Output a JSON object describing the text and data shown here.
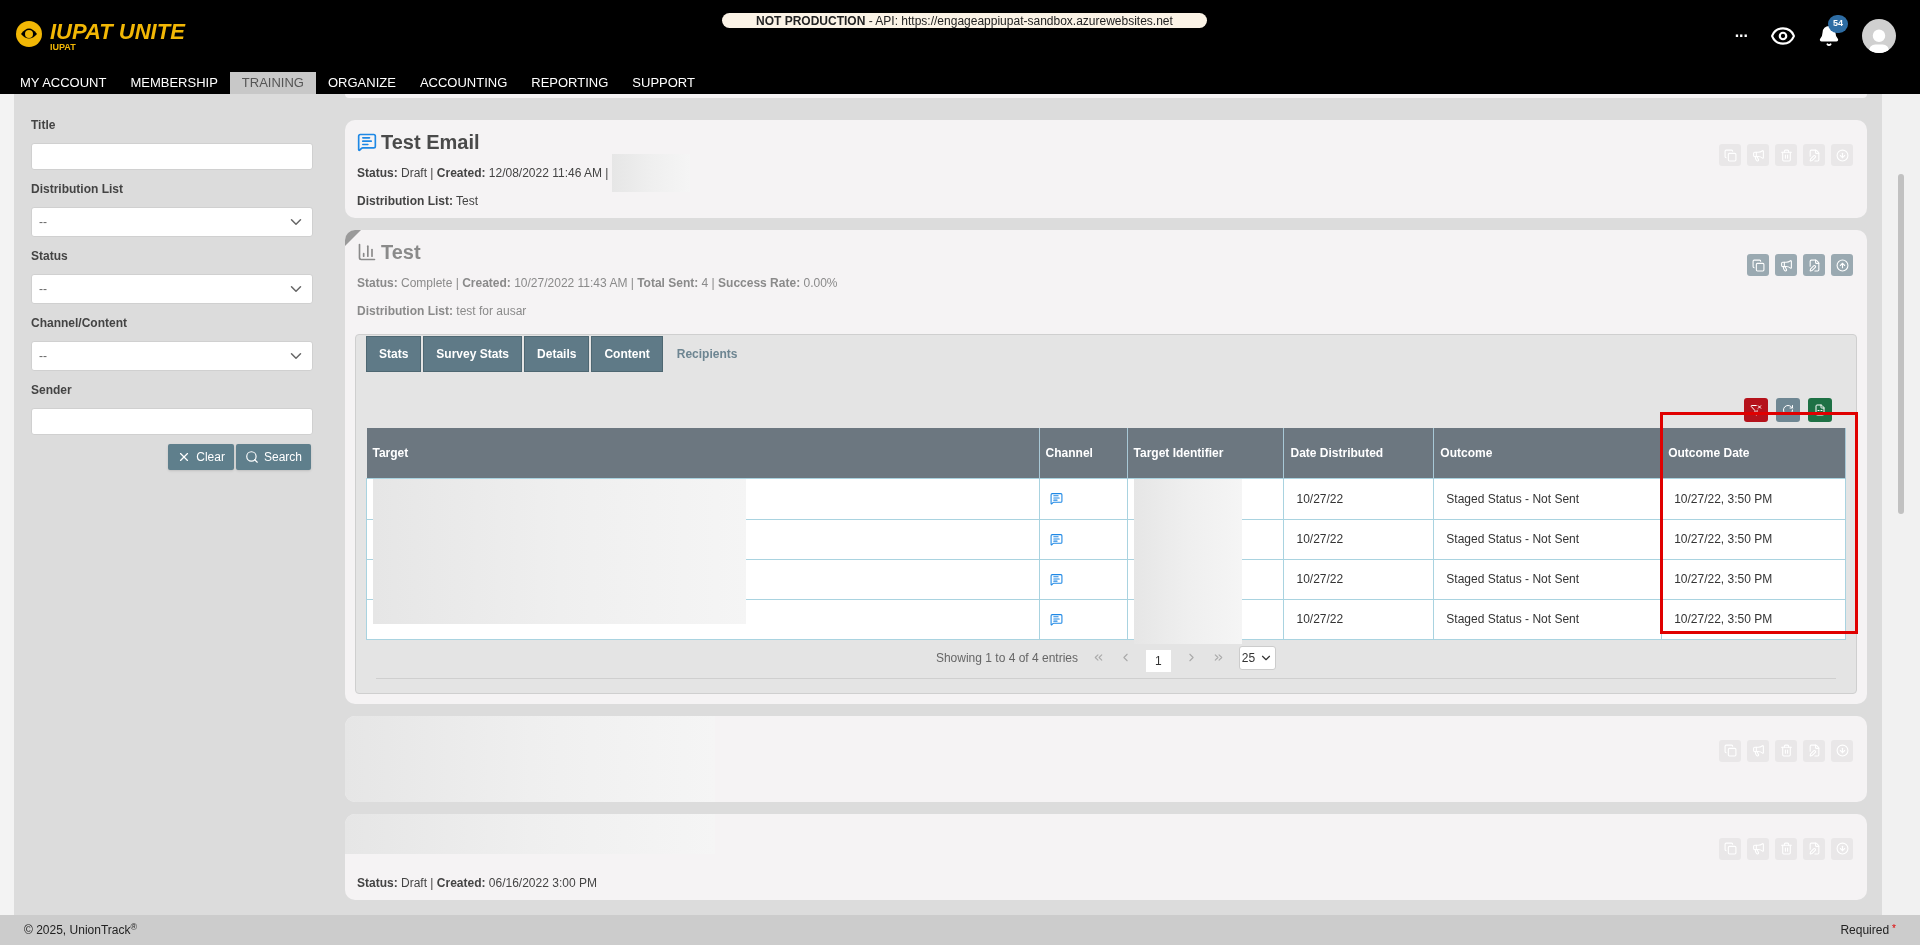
{
  "header": {
    "logo_text": "IUPAT UNITE",
    "logo_sub": "IUPAT",
    "env_label": "NOT PRODUCTION",
    "env_text": " - API: https://engageappiupat-sandbox.azurewebsites.net",
    "more": "...",
    "notification_count": "54"
  },
  "nav": [
    {
      "label": "MY ACCOUNT",
      "selected": false
    },
    {
      "label": "MEMBERSHIP",
      "selected": false
    },
    {
      "label": "TRAINING",
      "selected": true
    },
    {
      "label": "ORGANIZE",
      "selected": false
    },
    {
      "label": "ACCOUNTING",
      "selected": false
    },
    {
      "label": "REPORTING",
      "selected": false
    },
    {
      "label": "SUPPORT",
      "selected": false
    }
  ],
  "filter": {
    "fields": [
      {
        "label": "Title",
        "kind": "text"
      },
      {
        "label": "Distribution List",
        "kind": "select",
        "value": "--"
      },
      {
        "label": "Status",
        "kind": "select",
        "value": "--"
      },
      {
        "label": "Channel/Content",
        "kind": "select",
        "value": "--"
      },
      {
        "label": "Sender",
        "kind": "text"
      }
    ],
    "buttons": [
      {
        "label": "Clear",
        "kind": "clear"
      },
      {
        "label": "Search",
        "kind": "search"
      }
    ]
  },
  "cards": [
    {
      "kind": "email",
      "title": "Test Email",
      "meta": "**Status:** Draft | **Created:** 12/08/2022 11:46 AM |",
      "meta_redacted": true,
      "distribution": "**Distribution List:** Test",
      "faded": true,
      "actions": [
        {
          "kind": "copy"
        },
        {
          "kind": "announce"
        },
        {
          "kind": "delete"
        },
        {
          "kind": "edit"
        },
        {
          "kind": "download"
        }
      ]
    },
    {
      "kind": "survey",
      "title": "Test",
      "meta": "**Status:** Complete | **Created:** 10/27/2022 11:43 AM | **Total Sent:** 4 | **Success Rate:** 0.00%",
      "distribution": "**Distribution List:** test for ausar",
      "faded": false,
      "actions": [
        {
          "kind": "copy"
        },
        {
          "kind": "announce"
        },
        {
          "kind": "edit"
        },
        {
          "kind": "upload"
        }
      ],
      "details": {
        "tabs": [
          {
            "label": "Stats",
            "selected": false
          },
          {
            "label": "Survey Stats",
            "selected": false
          },
          {
            "label": "Details",
            "selected": false
          },
          {
            "label": "Content",
            "selected": false
          },
          {
            "label": "Recipients",
            "selected": true
          }
        ],
        "toolbar": [
          {
            "kind": "clear-filter"
          },
          {
            "kind": "refresh"
          },
          {
            "kind": "export"
          }
        ],
        "columns": [
          {
            "label": "Target",
            "highlighted": false
          },
          {
            "label": "Channel",
            "highlighted": false
          },
          {
            "label": "Target Identifier",
            "highlighted": false
          },
          {
            "label": "Date Distributed",
            "highlighted": false
          },
          {
            "label": "Outcome",
            "highlighted": false
          },
          {
            "label": "Outcome Date",
            "highlighted": true
          }
        ],
        "rows": [
          {
            "date": "10/27/22",
            "outcome": "Staged Status - Not Sent",
            "outcome_date": "10/27/22, 3:50 PM"
          },
          {
            "date": "10/27/22",
            "outcome": "Staged Status - Not Sent",
            "outcome_date": "10/27/22, 3:50 PM"
          },
          {
            "date": "10/27/22",
            "outcome": "Staged Status - Not Sent",
            "outcome_date": "10/27/22, 3:50 PM"
          },
          {
            "date": "10/27/22",
            "outcome": "Staged Status - Not Sent",
            "outcome_date": "10/27/22, 3:50 PM"
          }
        ],
        "pagination": {
          "summary": "Showing 1 to 4 of 4 entries",
          "page": "1",
          "page_size": "25"
        }
      }
    },
    {
      "kind": "hidden",
      "faded": true,
      "actions": [
        {
          "kind": "copy"
        },
        {
          "kind": "announce"
        },
        {
          "kind": "delete"
        },
        {
          "kind": "edit"
        },
        {
          "kind": "download"
        }
      ]
    },
    {
      "kind": "text",
      "title_hidden": true,
      "meta": "**Status:** Draft | **Created:** 06/16/2022 3:00 PM",
      "faded": true,
      "actions": [
        {
          "kind": "copy"
        },
        {
          "kind": "announce"
        },
        {
          "kind": "delete"
        },
        {
          "kind": "edit"
        },
        {
          "kind": "download"
        }
      ]
    }
  ],
  "footer": {
    "copyright": "© 2025, UnionTrack$^{®}$",
    "required": "Required",
    "required_mark": "*"
  }
}
